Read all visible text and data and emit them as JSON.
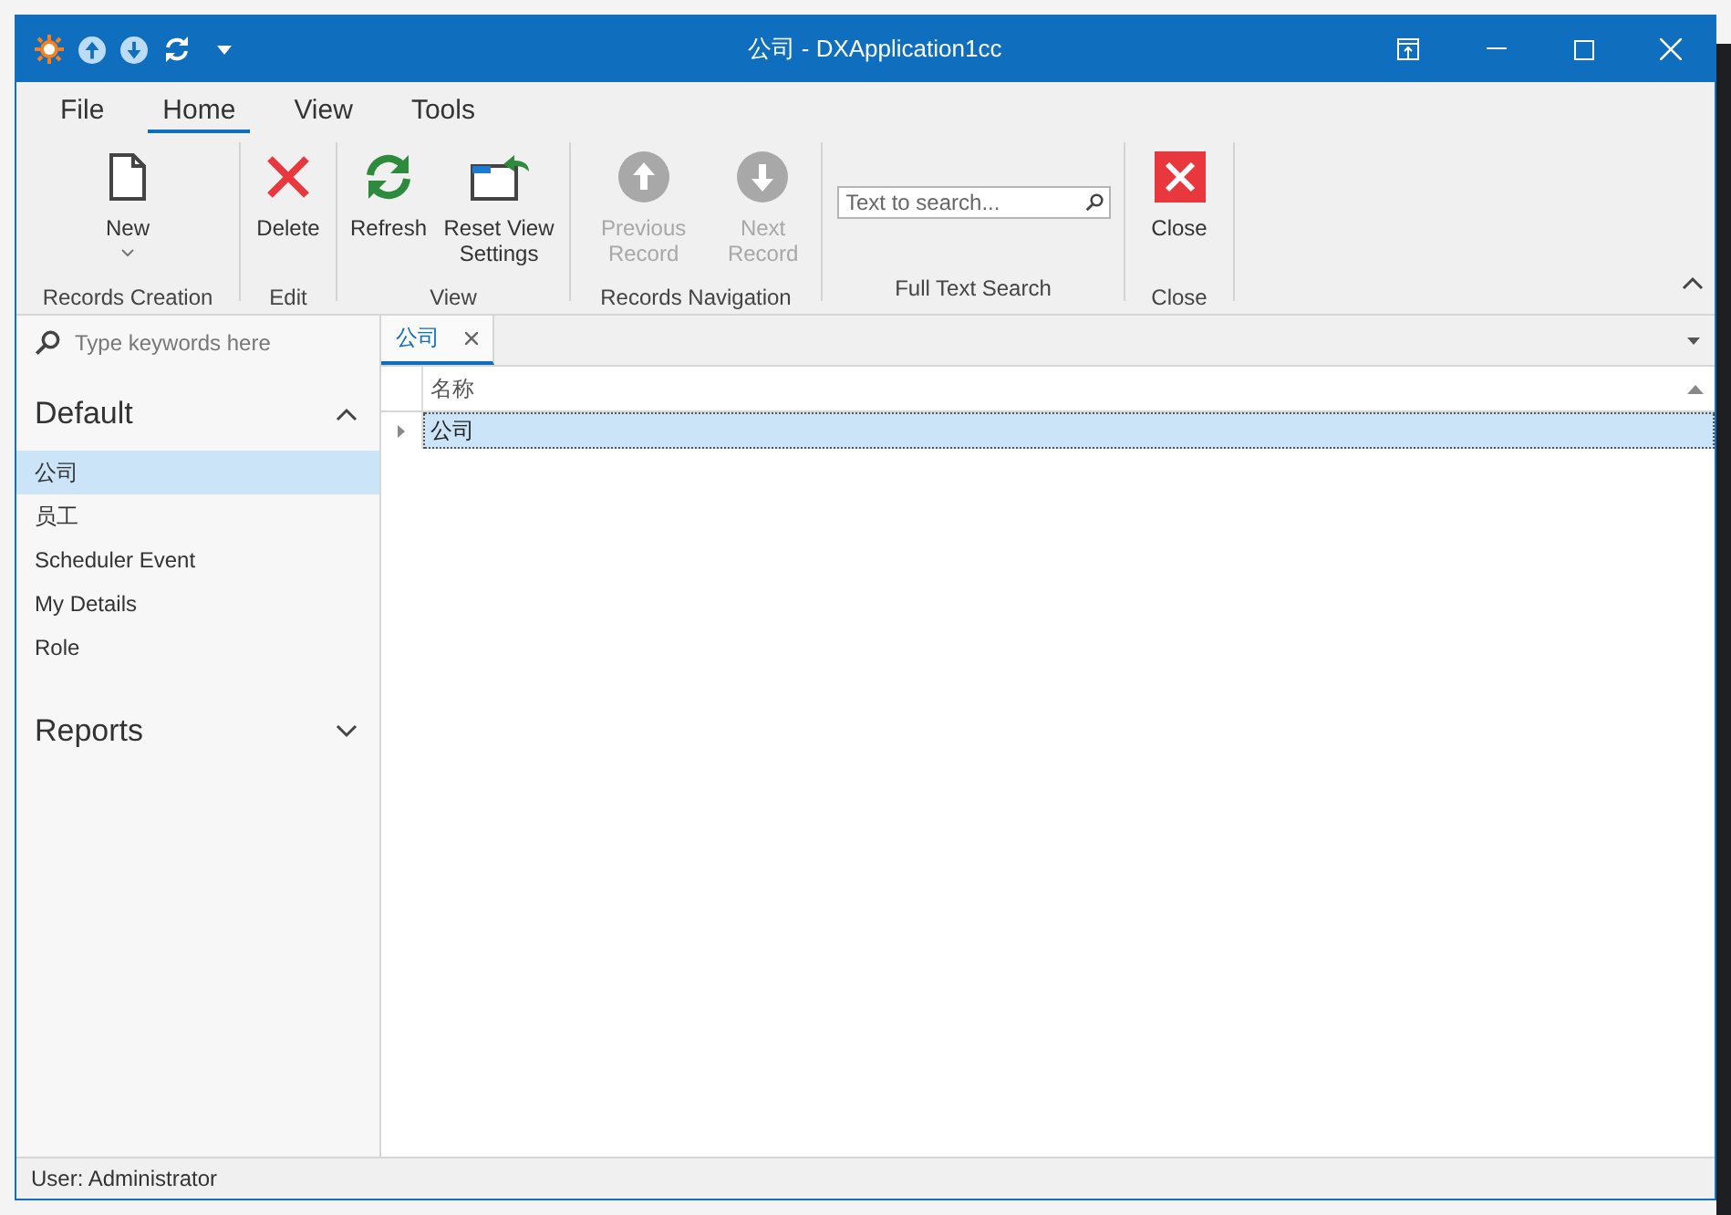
{
  "window": {
    "title": "公司 - DXApplication1cc"
  },
  "ribbon_tabs": [
    {
      "label": "File",
      "selected": false
    },
    {
      "label": "Home",
      "selected": true
    },
    {
      "label": "View",
      "selected": false
    },
    {
      "label": "Tools",
      "selected": false
    }
  ],
  "ribbon_groups": [
    {
      "label": "Records Creation",
      "items": [
        {
          "kind": "new",
          "label": "New",
          "dropdown": true,
          "disabled": false
        }
      ]
    },
    {
      "label": "Edit",
      "items": [
        {
          "kind": "delete",
          "label": "Delete",
          "disabled": false
        }
      ]
    },
    {
      "label": "View",
      "items": [
        {
          "kind": "refresh",
          "label": "Refresh",
          "disabled": false
        },
        {
          "kind": "reset",
          "label": "Reset View Settings",
          "disabled": false
        }
      ]
    },
    {
      "label": "Records Navigation",
      "items": [
        {
          "kind": "previous",
          "label": "Previous Record",
          "disabled": true
        },
        {
          "kind": "next",
          "label": "Next Record",
          "disabled": true
        }
      ]
    },
    {
      "label": "Full Text Search",
      "items": [
        {
          "kind": "search",
          "placeholder": "Text to search..."
        }
      ]
    },
    {
      "label": "Close",
      "items": [
        {
          "kind": "close",
          "label": "Close",
          "disabled": false
        }
      ]
    }
  ],
  "sidebar": {
    "search": {
      "placeholder": "Type keywords here"
    },
    "groups": [
      {
        "title": "Default",
        "expanded": true,
        "items": [
          {
            "label": "公司",
            "selected": true
          },
          {
            "label": "员工",
            "selected": false
          },
          {
            "label": "Scheduler Event",
            "selected": false
          },
          {
            "label": "My Details",
            "selected": false
          },
          {
            "label": "Role",
            "selected": false
          }
        ]
      },
      {
        "title": "Reports",
        "expanded": false
      }
    ]
  },
  "document_tabs": [
    {
      "label": "公司",
      "selected": true
    }
  ],
  "table": {
    "columns": [
      "名称"
    ],
    "rows": [
      {
        "cells": [
          "公司"
        ],
        "selected": true
      }
    ]
  },
  "status_bar": "User: Administrator"
}
